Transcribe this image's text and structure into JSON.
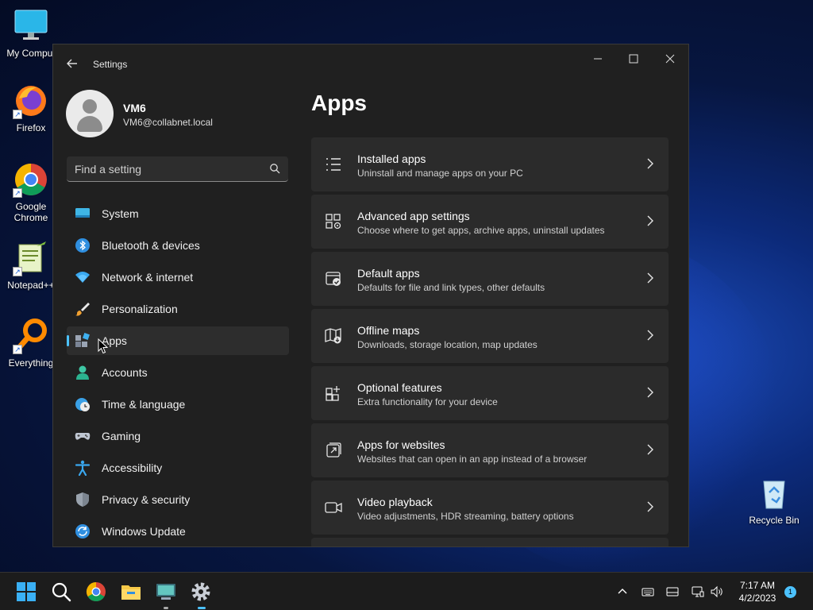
{
  "desktop": {
    "icons": [
      {
        "label": "My Comput"
      },
      {
        "label": "Firefox"
      },
      {
        "label": "Google Chrome"
      },
      {
        "label": "Notepad++"
      },
      {
        "label": "Everything"
      },
      {
        "label": "Recycle Bin"
      }
    ]
  },
  "window": {
    "title": "Settings",
    "controls": {
      "minimize": "—",
      "maximize": "☐",
      "close": "✕"
    }
  },
  "profile": {
    "name": "VM6",
    "email": "VM6@collabnet.local"
  },
  "search": {
    "placeholder": "Find a setting"
  },
  "nav": {
    "items": [
      {
        "label": "System",
        "icon": "monitor-icon"
      },
      {
        "label": "Bluetooth & devices",
        "icon": "bluetooth-icon"
      },
      {
        "label": "Network & internet",
        "icon": "wifi-icon"
      },
      {
        "label": "Personalization",
        "icon": "brush-icon"
      },
      {
        "label": "Apps",
        "icon": "apps-icon",
        "active": true
      },
      {
        "label": "Accounts",
        "icon": "person-icon"
      },
      {
        "label": "Time & language",
        "icon": "globe-clock-icon"
      },
      {
        "label": "Gaming",
        "icon": "gamepad-icon"
      },
      {
        "label": "Accessibility",
        "icon": "accessibility-icon"
      },
      {
        "label": "Privacy & security",
        "icon": "shield-icon"
      },
      {
        "label": "Windows Update",
        "icon": "update-icon"
      }
    ]
  },
  "main": {
    "title": "Apps",
    "cards": [
      {
        "title": "Installed apps",
        "subtitle": "Uninstall and manage apps on your PC",
        "icon": "list-icon"
      },
      {
        "title": "Advanced app settings",
        "subtitle": "Choose where to get apps, archive apps, uninstall updates",
        "icon": "app-settings-icon"
      },
      {
        "title": "Default apps",
        "subtitle": "Defaults for file and link types, other defaults",
        "icon": "default-apps-icon"
      },
      {
        "title": "Offline maps",
        "subtitle": "Downloads, storage location, map updates",
        "icon": "map-icon"
      },
      {
        "title": "Optional features",
        "subtitle": "Extra functionality for your device",
        "icon": "grid-add-icon"
      },
      {
        "title": "Apps for websites",
        "subtitle": "Websites that can open in an app instead of a browser",
        "icon": "open-link-icon"
      },
      {
        "title": "Video playback",
        "subtitle": "Video adjustments, HDR streaming, battery options",
        "icon": "video-icon"
      }
    ]
  },
  "taskbar": {
    "time": "7:17 AM",
    "date": "4/2/2023",
    "notification_count": "1"
  },
  "colors": {
    "accent": "#4cc2ff",
    "window_bg": "#202020",
    "card_bg": "#2b2b2b",
    "taskbar_bg": "#1c1c1c"
  }
}
